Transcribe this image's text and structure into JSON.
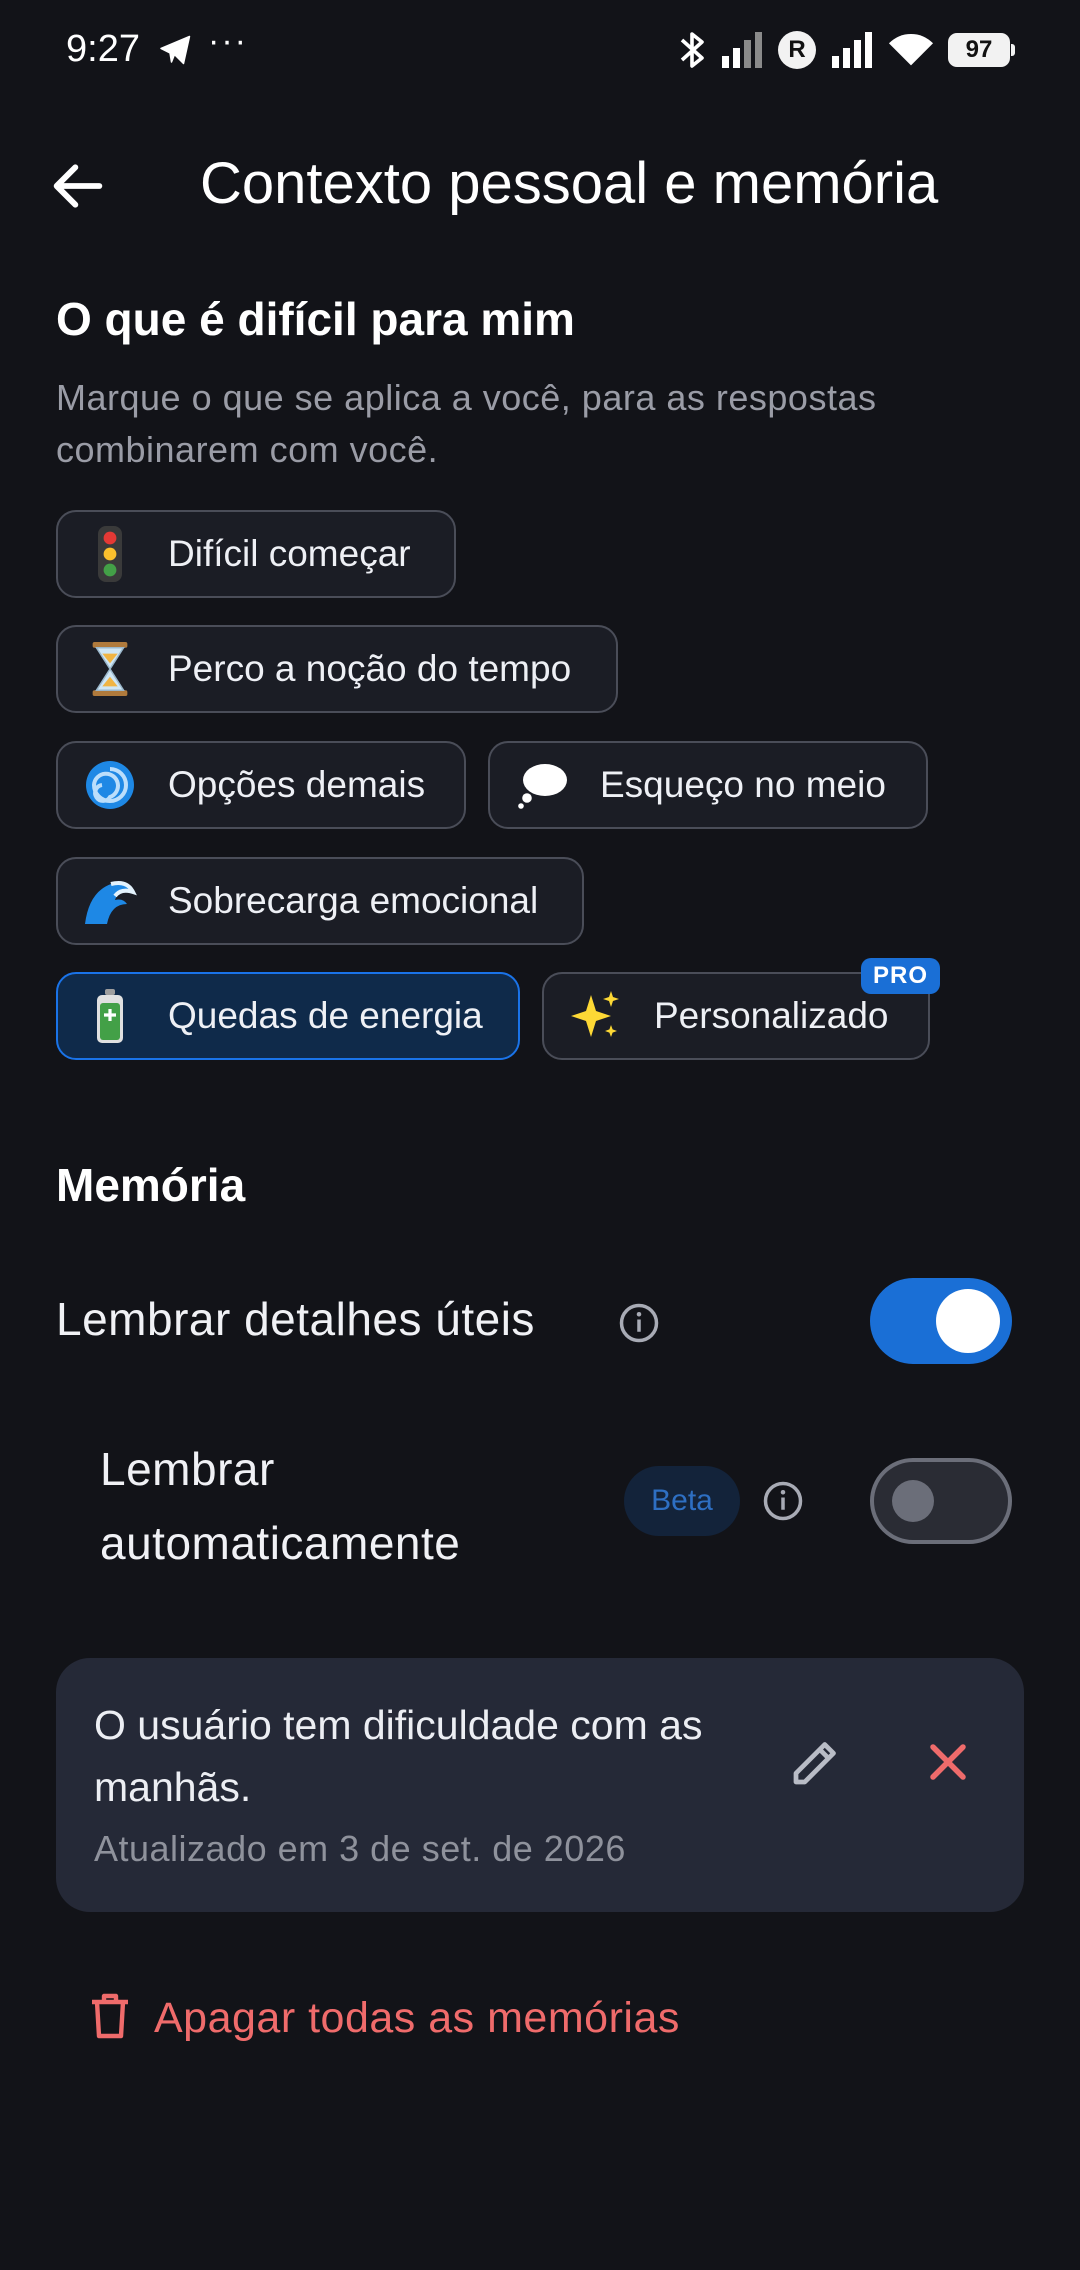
{
  "status_bar": {
    "time": "9:27",
    "overflow_dots": "···",
    "carrier_badge": "R",
    "battery": "97",
    "icons": [
      "telegram-icon",
      "bluetooth-icon",
      "signal-icon",
      "signal-icon",
      "wifi-icon",
      "battery-icon"
    ]
  },
  "header": {
    "title": "Contexto pessoal e memória",
    "back_icon": "arrow-left-icon"
  },
  "difficulties": {
    "title": "O que é difícil para mim",
    "subtitle": "Marque o que se aplica a você, para as respostas combinarem com você.",
    "chips": [
      {
        "label": "Difícil começar",
        "icon": "traffic-light",
        "selected": false
      },
      {
        "label": "Perco a noção do tempo",
        "icon": "hourglass",
        "selected": false
      },
      {
        "label": "Opções demais",
        "icon": "cyclone",
        "selected": false
      },
      {
        "label": "Esqueço no meio",
        "icon": "thought-bubble",
        "selected": false
      },
      {
        "label": "Sobrecarga emocional",
        "icon": "wave",
        "selected": false
      },
      {
        "label": "Quedas de energia",
        "icon": "battery",
        "selected": true
      },
      {
        "label": "Personalizado",
        "icon": "sparkles",
        "selected": false,
        "badge": "PRO"
      }
    ]
  },
  "memory": {
    "title": "Memória",
    "remember_details": {
      "label": "Lembrar detalhes úteis",
      "enabled": true
    },
    "auto_remember": {
      "label": "Lembrar automaticamente",
      "badge": "Beta",
      "enabled": false
    },
    "items": [
      {
        "text": "O usuário tem dificuldade com as manhãs.",
        "updated": "Atualizado em 3 de set. de 2026"
      }
    ],
    "delete_all_label": "Apagar todas as memórias"
  },
  "colors": {
    "background": "#121318",
    "accent": "#1a6fd6",
    "danger": "#ef6b6b",
    "card": "#252937"
  }
}
